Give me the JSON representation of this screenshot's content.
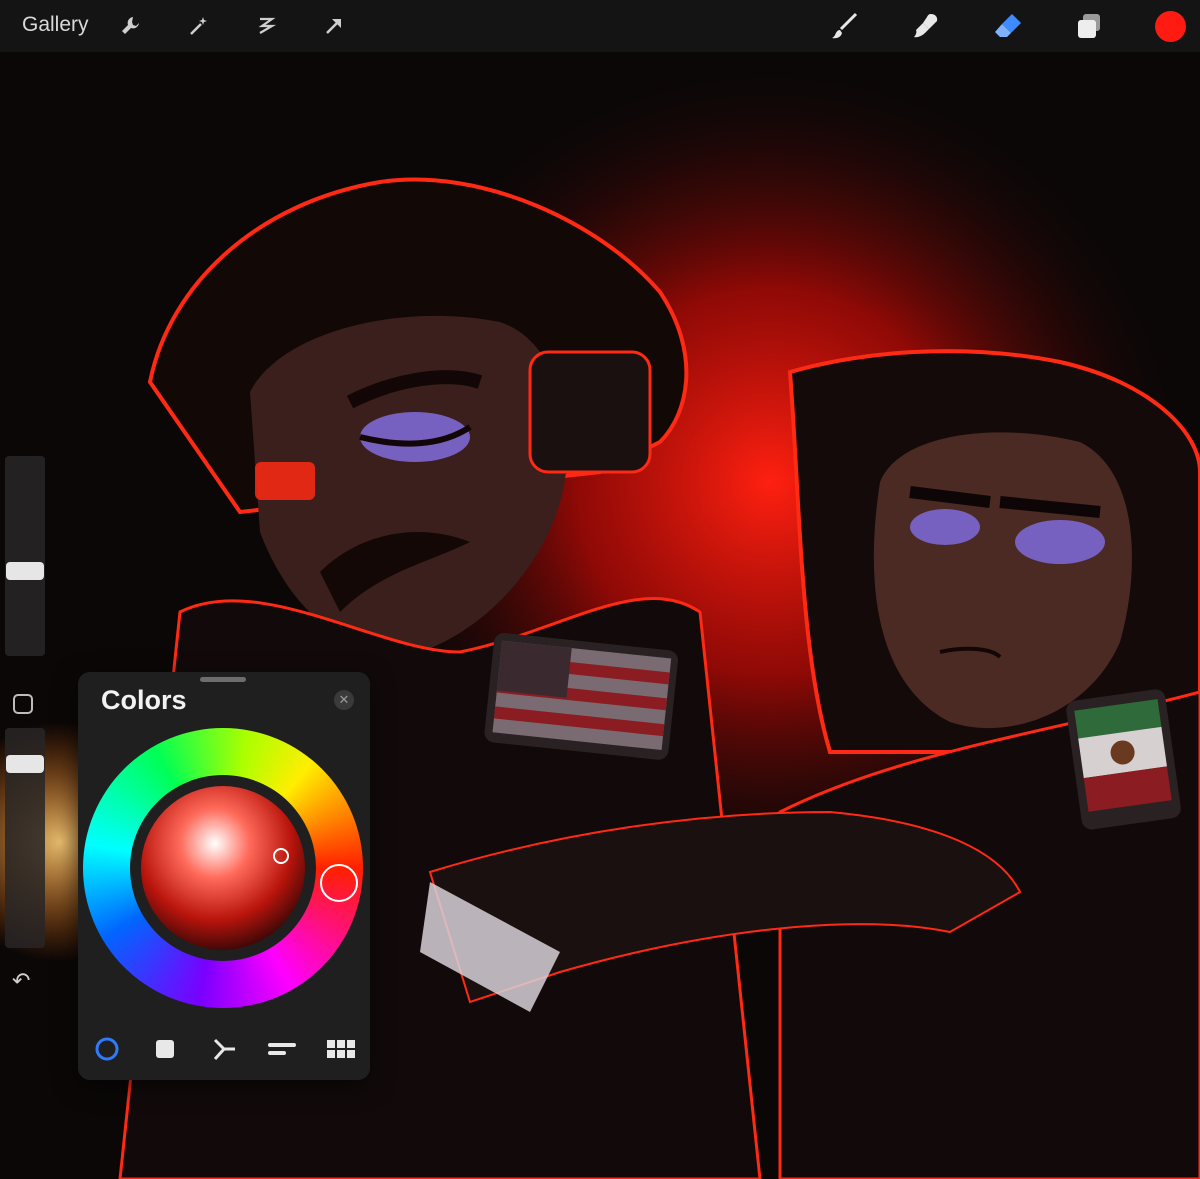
{
  "toolbar": {
    "gallery_label": "Gallery",
    "left_icons": [
      "wrench-icon",
      "magic-wand-icon",
      "selection-icon",
      "transform-arrow-icon"
    ],
    "right_icons": [
      "brush-icon",
      "smudge-icon",
      "eraser-icon",
      "layers-icon"
    ],
    "current_color": "#ff1a12",
    "active_tool": "eraser"
  },
  "sidebar": {
    "size_slider_level": 0.45,
    "opacity_slider_level": 0.95,
    "modify_icon": "square-outline-icon",
    "undo_icon": "undo-arrow-icon"
  },
  "colors_panel": {
    "title": "Colors",
    "close_icon": "close-icon",
    "selected_hue_color": "#ff3a2a",
    "selected_color": "#ff1a12",
    "tabs": [
      {
        "name": "disc",
        "icon": "circle-outline-icon",
        "active": true
      },
      {
        "name": "classic",
        "icon": "square-icon",
        "active": false
      },
      {
        "name": "harmony",
        "icon": "harmony-icon",
        "active": false
      },
      {
        "name": "value",
        "icon": "sliders-icon",
        "active": false
      },
      {
        "name": "palettes",
        "icon": "grid-icon",
        "active": false
      }
    ]
  },
  "accent_colors": {
    "active_tab": "#2f7bff",
    "toolbar_bg": "#141414",
    "panel_bg": "#1f1f1f"
  }
}
